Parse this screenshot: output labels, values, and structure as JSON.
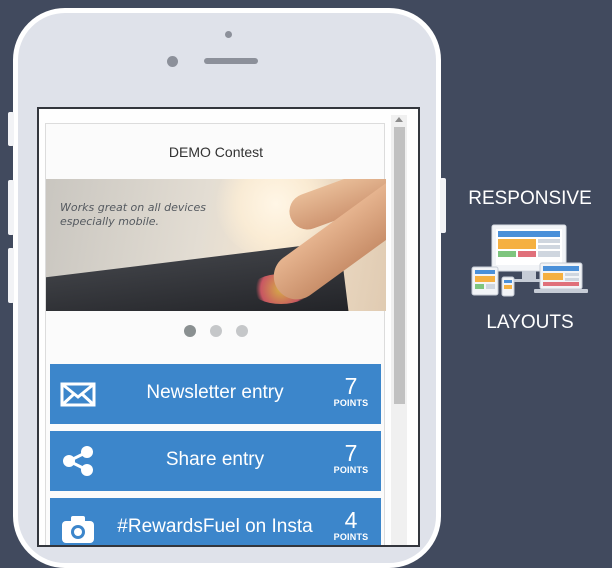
{
  "contest": {
    "title": "DEMO Contest",
    "hero_text": "Works great on all devices\nespecially mobile.",
    "slides": 3,
    "active_slide": 0
  },
  "entries": [
    {
      "label": "Newsletter entry",
      "points": "7",
      "points_label": "POINTS",
      "icon": "envelope-icon"
    },
    {
      "label": "Share entry",
      "points": "7",
      "points_label": "POINTS",
      "icon": "share-icon"
    },
    {
      "label": "#RewardsFuel on Insta",
      "points": "4",
      "points_label": "POINTS",
      "icon": "camera-icon"
    }
  ],
  "promo": {
    "title": "RESPONSIVE",
    "subtitle": "LAYOUTS",
    "icon": "responsive-devices-icon"
  },
  "colors": {
    "background": "#414a5e",
    "entry_button": "#3c86cb",
    "phone_body": "#dfe2ea"
  }
}
